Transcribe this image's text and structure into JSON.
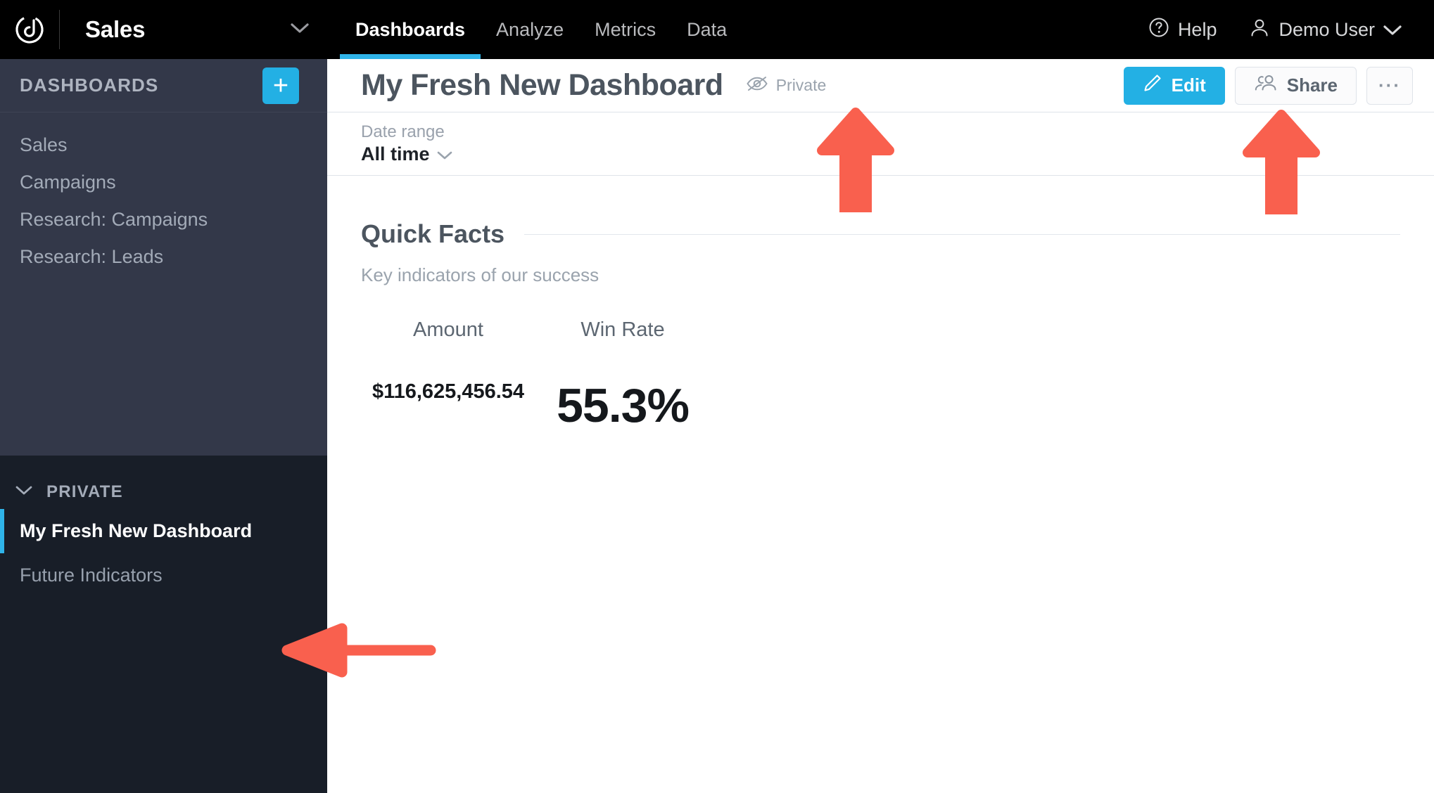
{
  "topnav": {
    "logo_icon": "datahero-logo-icon",
    "account_name": "Sales",
    "account_chevron_icon": "chevron-down-icon",
    "tabs": [
      {
        "label": "Dashboards",
        "active": true
      },
      {
        "label": "Analyze",
        "active": false
      },
      {
        "label": "Metrics",
        "active": false
      },
      {
        "label": "Data",
        "active": false
      }
    ],
    "help": {
      "label": "Help",
      "icon": "question-circle-icon"
    },
    "user": {
      "label": "Demo User",
      "icon": "user-icon",
      "chevron_icon": "chevron-down-icon"
    }
  },
  "sidebar": {
    "header_title": "DASHBOARDS",
    "add_button_label": "+",
    "items": [
      {
        "label": "Sales"
      },
      {
        "label": "Campaigns"
      },
      {
        "label": "Research: Campaigns"
      },
      {
        "label": "Research: Leads"
      }
    ],
    "private_section": {
      "title": "PRIVATE",
      "chevron_icon": "chevron-down-icon",
      "items": [
        {
          "label": "My Fresh New Dashboard",
          "active": true
        },
        {
          "label": "Future Indicators",
          "active": false
        }
      ]
    }
  },
  "dashboard": {
    "title": "My Fresh New Dashboard",
    "privacy": {
      "label": "Private",
      "icon": "eye-off-icon"
    },
    "actions": {
      "edit": {
        "label": "Edit",
        "icon": "pencil-icon"
      },
      "share": {
        "label": "Share",
        "icon": "people-icon"
      },
      "more": {
        "label": "···",
        "icon": "ellipsis-icon"
      }
    },
    "filter": {
      "label": "Date range",
      "value": "All time",
      "chevron_icon": "chevron-down-icon"
    },
    "section": {
      "title": "Quick Facts",
      "subtitle": "Key indicators of our success",
      "tiles": [
        {
          "label": "Amount",
          "value": "$116,625,456.54",
          "size": "small"
        },
        {
          "label": "Win Rate",
          "value": "55.3%",
          "size": "large"
        }
      ]
    }
  },
  "annotations": {
    "color": "#f9604e",
    "arrows": [
      {
        "name": "arrow-pointing-to-private-badge",
        "direction": "up"
      },
      {
        "name": "arrow-pointing-to-share-button",
        "direction": "up"
      },
      {
        "name": "arrow-pointing-to-active-dashboard",
        "direction": "left"
      }
    ]
  },
  "theme": {
    "accent": "#23b0e4",
    "sidebar_bg": "#333849",
    "sidebar_private_bg": "#181e28",
    "topnav_bg": "#000000",
    "annotation_red": "#f9604e"
  }
}
